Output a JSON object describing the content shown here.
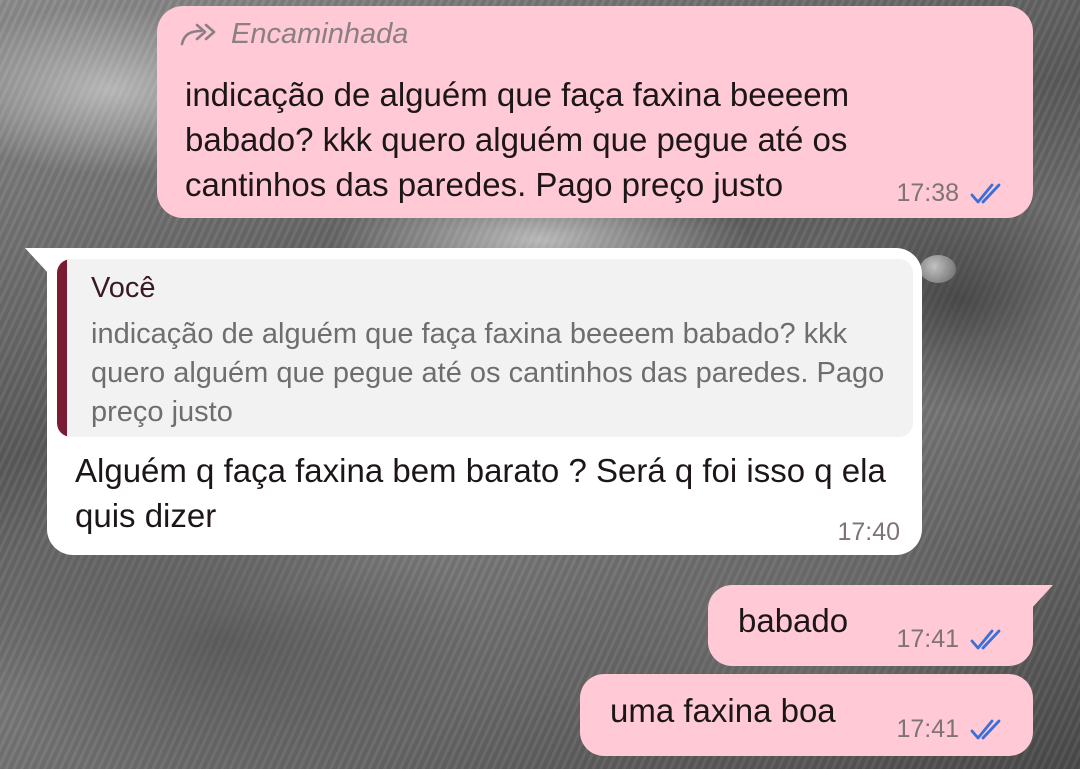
{
  "chat": {
    "messages": [
      {
        "direction": "outgoing",
        "forwarded_label": "Encaminhada",
        "text": "indicação de alguém que faça faxina beeeem babado? kkk quero alguém que pegue até os cantinhos das paredes. Pago preço justo",
        "time": "17:38",
        "status_icon": "double-check-read-icon"
      },
      {
        "direction": "incoming",
        "reply_to": {
          "author": "Você",
          "text": "indicação de alguém que faça faxina beeeem babado? kkk quero alguém que pegue até os cantinhos das paredes. Pago preço justo"
        },
        "text": "Alguém q faça faxina bem barato ? Será q foi isso q ela quis dizer",
        "time": "17:40"
      },
      {
        "direction": "outgoing",
        "text": "babado",
        "time": "17:41",
        "status_icon": "double-check-read-icon"
      },
      {
        "direction": "outgoing",
        "text": "uma faxina boa",
        "time": "17:41",
        "status_icon": "double-check-read-icon"
      }
    ]
  },
  "colors": {
    "outgoing_bubble": "#ffc9d6",
    "incoming_bubble": "#ffffff",
    "quote_bar": "#7a1d34",
    "read_tick": "#3b6fd8"
  }
}
